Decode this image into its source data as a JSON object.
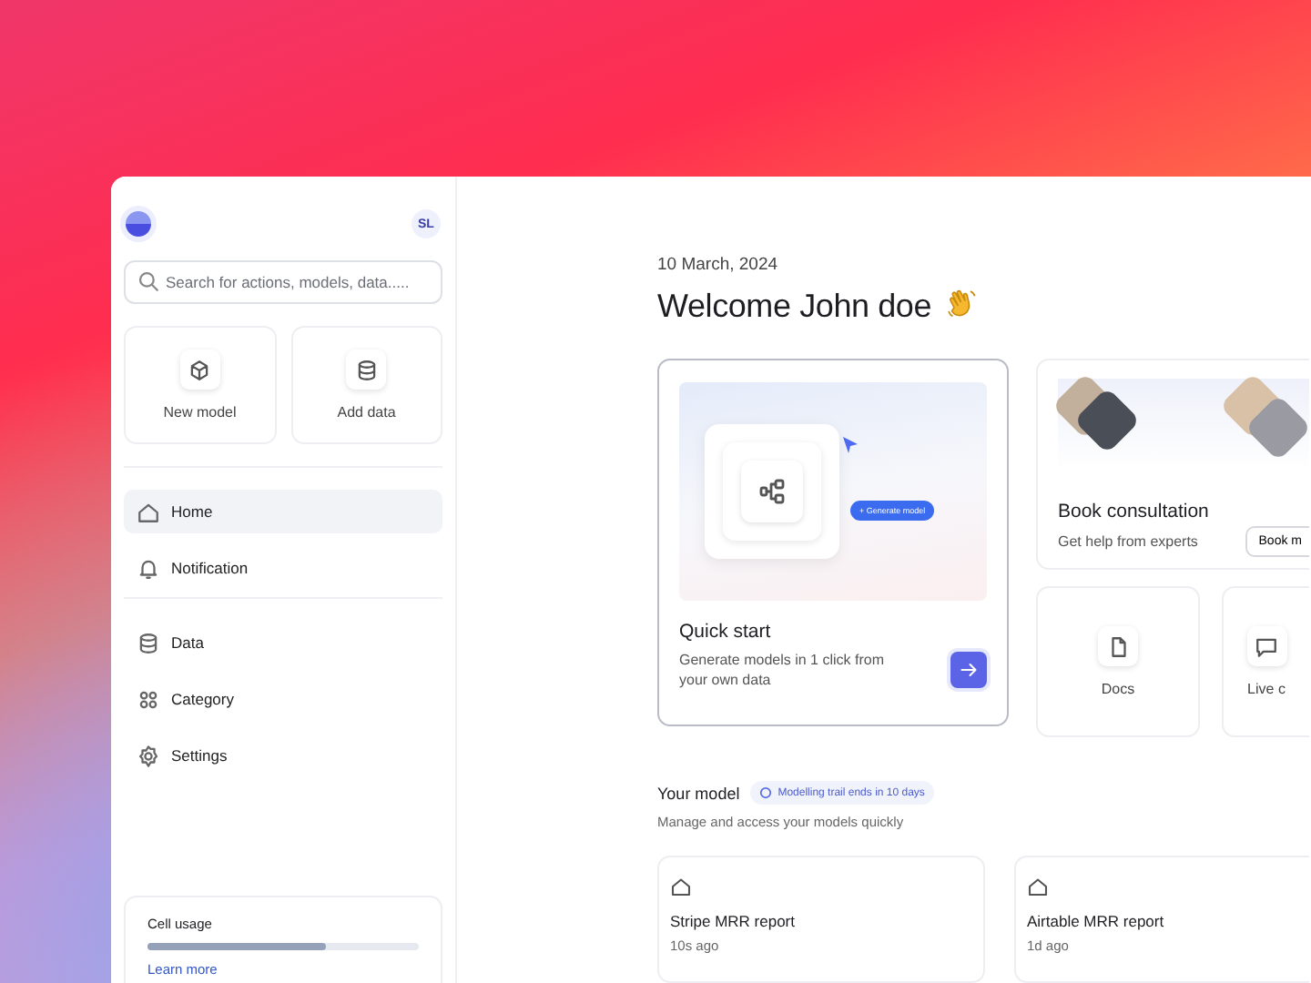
{
  "sidebar": {
    "avatar": "SL",
    "search": {
      "placeholder": "Search for actions, models, data....."
    },
    "quick_actions": [
      {
        "label": "New model",
        "kind": "cube"
      },
      {
        "label": "Add data",
        "kind": "database"
      }
    ],
    "nav_groups": [
      [
        {
          "label": "Home",
          "kind": "home",
          "selected": true
        },
        {
          "label": "Notification",
          "kind": "bell",
          "selected": false
        }
      ],
      [
        {
          "label": "Data",
          "kind": "database",
          "selected": false
        },
        {
          "label": "Category",
          "kind": "grid",
          "selected": false
        },
        {
          "label": "Settings",
          "kind": "gear",
          "selected": false
        }
      ]
    ],
    "usage": {
      "title": "Cell usage",
      "level": 0.66,
      "link": "Learn more"
    }
  },
  "main": {
    "date": "10 March, 2024",
    "greeting": "Welcome John doe",
    "quick_start": {
      "badge": "+ Generate model",
      "title": "Quick start",
      "text": "Generate models in 1 click from your own data"
    },
    "consultation": {
      "title": "Book consultation",
      "subtitle": "Get help from experts",
      "button": "Book m"
    },
    "shortcuts": [
      {
        "label": "Docs",
        "kind": "doc"
      },
      {
        "label": "Live c",
        "kind": "chat"
      }
    ],
    "models_section": {
      "title": "Your model",
      "badge": "Modelling trail ends in 10 days",
      "subtitle": "Manage and access your models quickly"
    },
    "models": [
      {
        "name": "Stripe MRR report",
        "time": "10s ago"
      },
      {
        "name": "Airtable MRR report",
        "time": "1d ago"
      }
    ]
  }
}
